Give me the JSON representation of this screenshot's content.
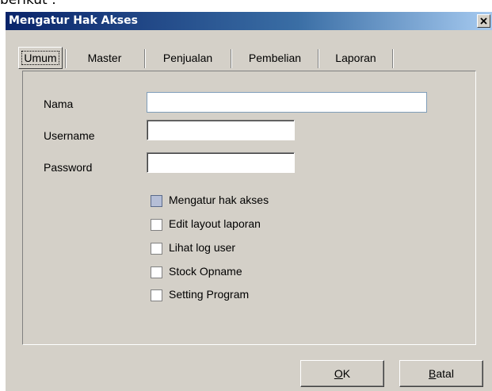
{
  "caption": "berikut :",
  "window": {
    "title": "Mengatur Hak Akses"
  },
  "tabs": [
    {
      "label": "Umum"
    },
    {
      "label": "Master"
    },
    {
      "label": "Penjualan"
    },
    {
      "label": "Pembelian"
    },
    {
      "label": "Laporan"
    }
  ],
  "form": {
    "nama_label": "Nama",
    "nama_value": "",
    "username_label": "Username",
    "username_value": "",
    "password_label": "Password",
    "password_value": ""
  },
  "permissions": [
    {
      "label": "Mengatur hak akses",
      "checked": true
    },
    {
      "label": "Edit layout laporan",
      "checked": false
    },
    {
      "label": "Lihat log user",
      "checked": false
    },
    {
      "label": "Stock Opname",
      "checked": false
    },
    {
      "label": "Setting Program",
      "checked": false
    }
  ],
  "buttons": {
    "ok_mnemonic": "O",
    "ok_rest": "K",
    "batal_mnemonic": "B",
    "batal_rest": "atal"
  }
}
